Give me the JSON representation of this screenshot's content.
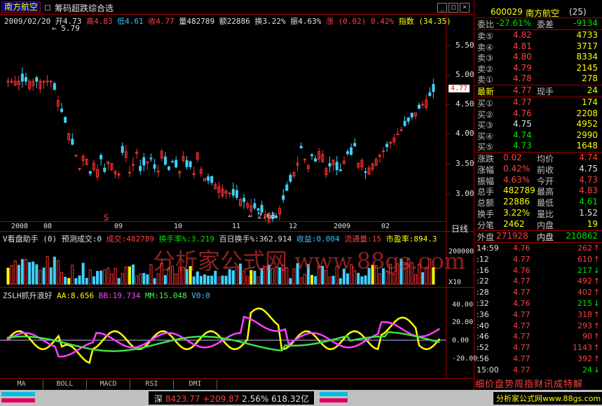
{
  "window": {
    "stock_name": "南方航空",
    "selector_label": "筹码超跌综合选"
  },
  "info_line": {
    "date": "2009/02/20",
    "open": "开4.73",
    "high": "高4.83",
    "low": "低4.61",
    "close": "收4.77",
    "volume": "量482789",
    "amount": "额22886",
    "turnover": "换3.22%",
    "amplitude": "振4.63%",
    "change": "涨 (0.02) 0.42%",
    "index": "指数 (34.35)"
  },
  "price_axis": [
    "5.50",
    "5.00",
    "4.50",
    "4.00",
    "3.50",
    "3.00"
  ],
  "price_marks": {
    "high_label": "5.79",
    "low_label": "2.65",
    "current": "4.77"
  },
  "date_axis": [
    "2008",
    "08",
    "09",
    "10",
    "11",
    "12",
    "2009",
    "02"
  ],
  "axis_mode": "日线",
  "vol_panel": {
    "title": "V看盘助手 (0)",
    "predict": "预测成交:0",
    "vol": "成交:482789",
    "turn": "换手率%:3.219",
    "turn100": "百日换手%:362.914",
    "gain": "收益:0.004",
    "float": "流通量:15",
    "pe": "市盈率:894.3",
    "axis_top": "200000",
    "axis_unit": "X10"
  },
  "osc_panel": {
    "title": "ZSLH抓升浪好",
    "aa": "AA:8.656",
    "bb": "BB:19.734",
    "mm": "MM:15.048",
    "v0": "V0:0",
    "axis": [
      "40.00",
      "20.00",
      "0.00",
      "-20.00"
    ]
  },
  "watermark": "分析家公式网 www.88gs.com",
  "tabs": [
    "MA",
    "BOLL",
    "MACD",
    "RSI",
    "DMI"
  ],
  "quote": {
    "code": "600029",
    "name": "南方航空",
    "rank": "(25)",
    "weibi_label": "委比",
    "weibi": "-27.61%",
    "weicha_label": "委差",
    "weicha": "-9134",
    "asks": [
      {
        "label": "卖⑤",
        "price": "4.82",
        "vol": "4733"
      },
      {
        "label": "卖④",
        "price": "4.81",
        "vol": "3717"
      },
      {
        "label": "卖③",
        "price": "4.80",
        "vol": "8334"
      },
      {
        "label": "卖②",
        "price": "4.79",
        "vol": "2145"
      },
      {
        "label": "卖①",
        "price": "4.78",
        "vol": "278"
      }
    ],
    "last": {
      "label": "最新",
      "price": "4.77",
      "label2": "现手",
      "vol": "24"
    },
    "bids": [
      {
        "label": "买①",
        "price": "4.77",
        "vol": "174"
      },
      {
        "label": "买②",
        "price": "4.76",
        "vol": "2208"
      },
      {
        "label": "买③",
        "price": "4.75",
        "vol": "4952"
      },
      {
        "label": "买④",
        "price": "4.74",
        "vol": "2990"
      },
      {
        "label": "买⑤",
        "price": "4.73",
        "vol": "1648"
      }
    ],
    "stats": [
      {
        "l1": "涨跌",
        "v1": "0.02",
        "l2": "均价",
        "v2": "4.74"
      },
      {
        "l1": "涨幅",
        "v1": "0.42%",
        "l2": "前收",
        "v2": "4.75"
      },
      {
        "l1": "振幅",
        "v1": "4.63%",
        "l2": "今开",
        "v2": "4.73"
      },
      {
        "l1": "总手",
        "v1": "482789",
        "l2": "最高",
        "v2": "4.83"
      },
      {
        "l1": "总额",
        "v1": "22886",
        "l2": "最低",
        "v2": "4.61"
      },
      {
        "l1": "换手",
        "v1": "3.22%",
        "l2": "量比",
        "v2": "1.52"
      },
      {
        "l1": "分笔",
        "v1": "2462",
        "l2": "内盘",
        "v2": "19"
      }
    ],
    "outer_label": "外盘",
    "outer": "271928",
    "inner_label": "内盘",
    "inner": "210862",
    "ticks": [
      {
        "t": "14:59",
        "p": "4.76",
        "v": "262",
        "d": "↑"
      },
      {
        "t": ":12",
        "p": "4.77",
        "v": "610",
        "d": "↑"
      },
      {
        "t": ":16",
        "p": "4.76",
        "v": "217",
        "d": "↓"
      },
      {
        "t": ":22",
        "p": "4.77",
        "v": "492",
        "d": "↑"
      },
      {
        "t": ":28",
        "p": "4.77",
        "v": "402",
        "d": "↑"
      },
      {
        "t": ":32",
        "p": "4.76",
        "v": "215",
        "d": "↓"
      },
      {
        "t": ":36",
        "p": "4.77",
        "v": "318",
        "d": "↑"
      },
      {
        "t": ":40",
        "p": "4.77",
        "v": "293",
        "d": "↑"
      },
      {
        "t": ":46",
        "p": "4.77",
        "v": "90",
        "d": "↑"
      },
      {
        "t": ":52",
        "p": "4.77",
        "v": "1143",
        "d": "↑"
      },
      {
        "t": ":56",
        "p": "4.77",
        "v": "392",
        "d": "↑"
      },
      {
        "t": "15:00",
        "p": "4.77",
        "v": "24",
        "d": "↓"
      }
    ],
    "menu": "细价盘势周指财讯成特解"
  },
  "statusbar": {
    "index_name": "深",
    "index_val": "8423.77",
    "index_chg": "+209.87",
    "index_pct": "2.56%",
    "index_amt": "618.32亿",
    "site": "分析家公式网www.88gs.com"
  }
}
